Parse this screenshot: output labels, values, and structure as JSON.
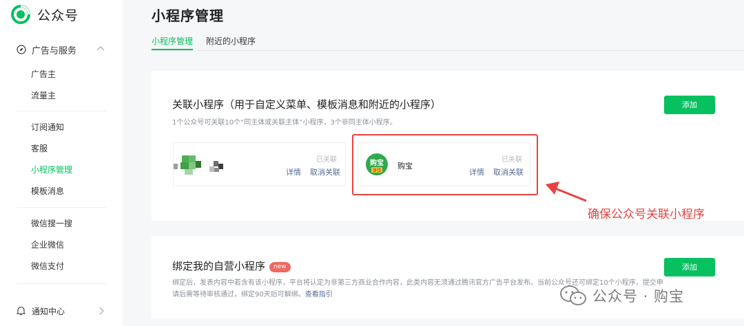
{
  "brand": {
    "name": "公众号"
  },
  "sidebar": {
    "group_label": "广告与服务",
    "items": [
      "广告主",
      "流量主",
      "订阅通知",
      "客服",
      "小程序管理",
      "模板消息",
      "微信搜一搜",
      "企业微信",
      "微信支付"
    ],
    "active_item": "小程序管理",
    "notify_label": "通知中心"
  },
  "page": {
    "title": "小程序管理",
    "tabs": [
      {
        "label": "小程序管理",
        "active": true
      },
      {
        "label": "附近的小程序",
        "active": false
      }
    ]
  },
  "linked_card": {
    "title": "关联小程序（用于自定义菜单、模板消息和附近的小程序）",
    "subtitle": "1个公众号可关联10个“同主体或关联主体”小程序，3个非同主体小程序。",
    "add_label": "添加",
    "mini_programs": [
      {
        "name": "",
        "status": "已关联",
        "detail_label": "详情",
        "unlink_label": "取消关联"
      },
      {
        "name": "购宝",
        "logo_text": "购宝",
        "logo_subtext": "省钱",
        "status": "已关联",
        "detail_label": "详情",
        "unlink_label": "取消关联"
      }
    ]
  },
  "annotation": {
    "text": "确保公众号关联小程序",
    "color": "#e64340"
  },
  "own_card": {
    "title": "绑定我的自营小程序",
    "badge": "new",
    "description": "绑定后，发表内容中若含有该小程序，平台将认定为非第三方商业合作内容，此类内容无须通过腾讯官方广告平台发布。当前公众号还可绑定10个小程序，提交申请后需等待审核通过，绑定90天后可解绑。",
    "link_label": "查看指引",
    "add_label": "添加"
  },
  "watermark": {
    "text": "公众号 · 购宝"
  },
  "colors": {
    "accent": "#07c160",
    "link": "#576b95",
    "alert": "#e64340"
  },
  "icons": [
    "wechat-official-logo",
    "compass-icon",
    "chevron-up-icon",
    "bell-icon",
    "chevron-right-icon",
    "wechat-watermark-icon"
  ]
}
